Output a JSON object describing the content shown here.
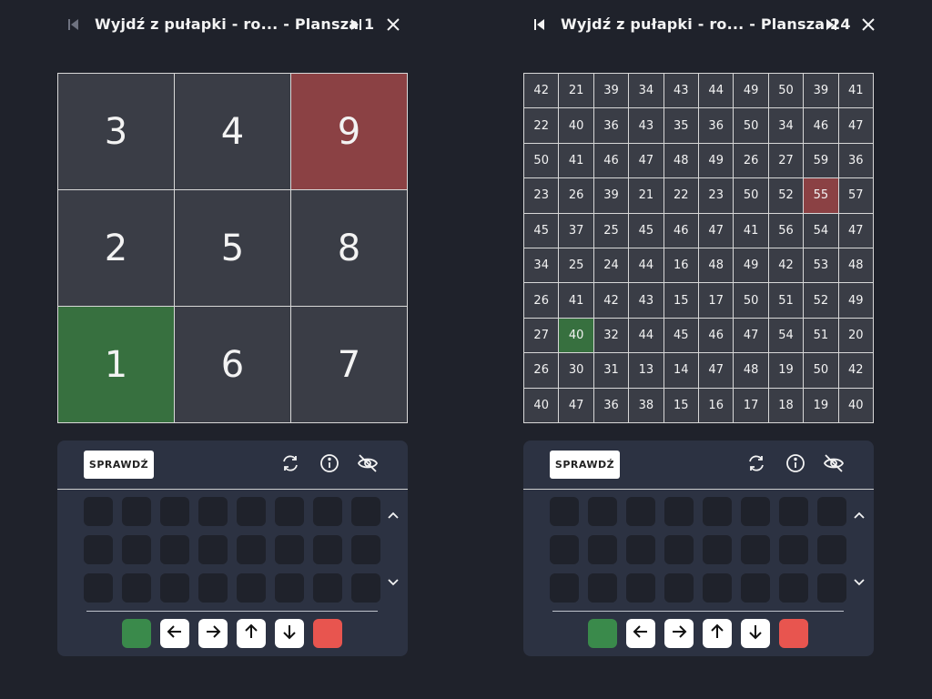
{
  "colors": {
    "background": "#1f222b",
    "cell": "#3a3d46",
    "start_cell": "#37703f",
    "end_cell": "#8b4144",
    "controls_panel": "#2c3242",
    "slot": "#1f222b",
    "palette_green": "#3a8a4b",
    "palette_red": "#e8554f"
  },
  "panels": [
    {
      "title": "Wyjdź z pułapki - ro... - Plansza 1",
      "board": {
        "rows": 3,
        "cols": 3,
        "cells": [
          [
            "3",
            "4",
            "9"
          ],
          [
            "2",
            "5",
            "8"
          ],
          [
            "1",
            "6",
            "7"
          ]
        ],
        "start_cell": [
          2,
          0
        ],
        "end_cell": [
          0,
          2
        ]
      },
      "controls": {
        "check_label": "SPRAWDŹ"
      }
    },
    {
      "title": "Wyjdź z pułapki - ro... - Plansza 24",
      "board": {
        "rows": 10,
        "cols": 10,
        "cells": [
          [
            "42",
            "21",
            "39",
            "34",
            "43",
            "44",
            "49",
            "50",
            "39",
            "41"
          ],
          [
            "22",
            "40",
            "36",
            "43",
            "35",
            "36",
            "50",
            "34",
            "46",
            "47"
          ],
          [
            "50",
            "41",
            "46",
            "47",
            "48",
            "49",
            "26",
            "27",
            "59",
            "36"
          ],
          [
            "23",
            "26",
            "39",
            "21",
            "22",
            "23",
            "50",
            "52",
            "55",
            "57"
          ],
          [
            "45",
            "37",
            "25",
            "45",
            "46",
            "47",
            "41",
            "56",
            "54",
            "47"
          ],
          [
            "34",
            "25",
            "24",
            "44",
            "16",
            "48",
            "49",
            "42",
            "53",
            "48"
          ],
          [
            "26",
            "41",
            "42",
            "43",
            "15",
            "17",
            "50",
            "51",
            "52",
            "49"
          ],
          [
            "27",
            "40",
            "32",
            "44",
            "45",
            "46",
            "47",
            "54",
            "51",
            "20"
          ],
          [
            "26",
            "30",
            "31",
            "13",
            "14",
            "47",
            "48",
            "19",
            "50",
            "42"
          ],
          [
            "40",
            "47",
            "36",
            "38",
            "15",
            "16",
            "17",
            "18",
            "19",
            "40"
          ]
        ],
        "start_cell": [
          7,
          1
        ],
        "end_cell": [
          3,
          8
        ]
      },
      "controls": {
        "check_label": "SPRAWDŹ"
      }
    }
  ],
  "icons": {
    "first": "skip-back-icon",
    "last": "skip-forward-icon",
    "close": "close-icon",
    "reset": "refresh-icon",
    "info": "info-icon",
    "hide": "eye-off-icon",
    "scroll_up": "chevron-up-icon",
    "scroll_down": "chevron-down-icon",
    "palette": [
      "green-color",
      "arrow-left-icon",
      "arrow-right-icon",
      "arrow-up-icon",
      "arrow-down-icon",
      "red-color"
    ]
  }
}
